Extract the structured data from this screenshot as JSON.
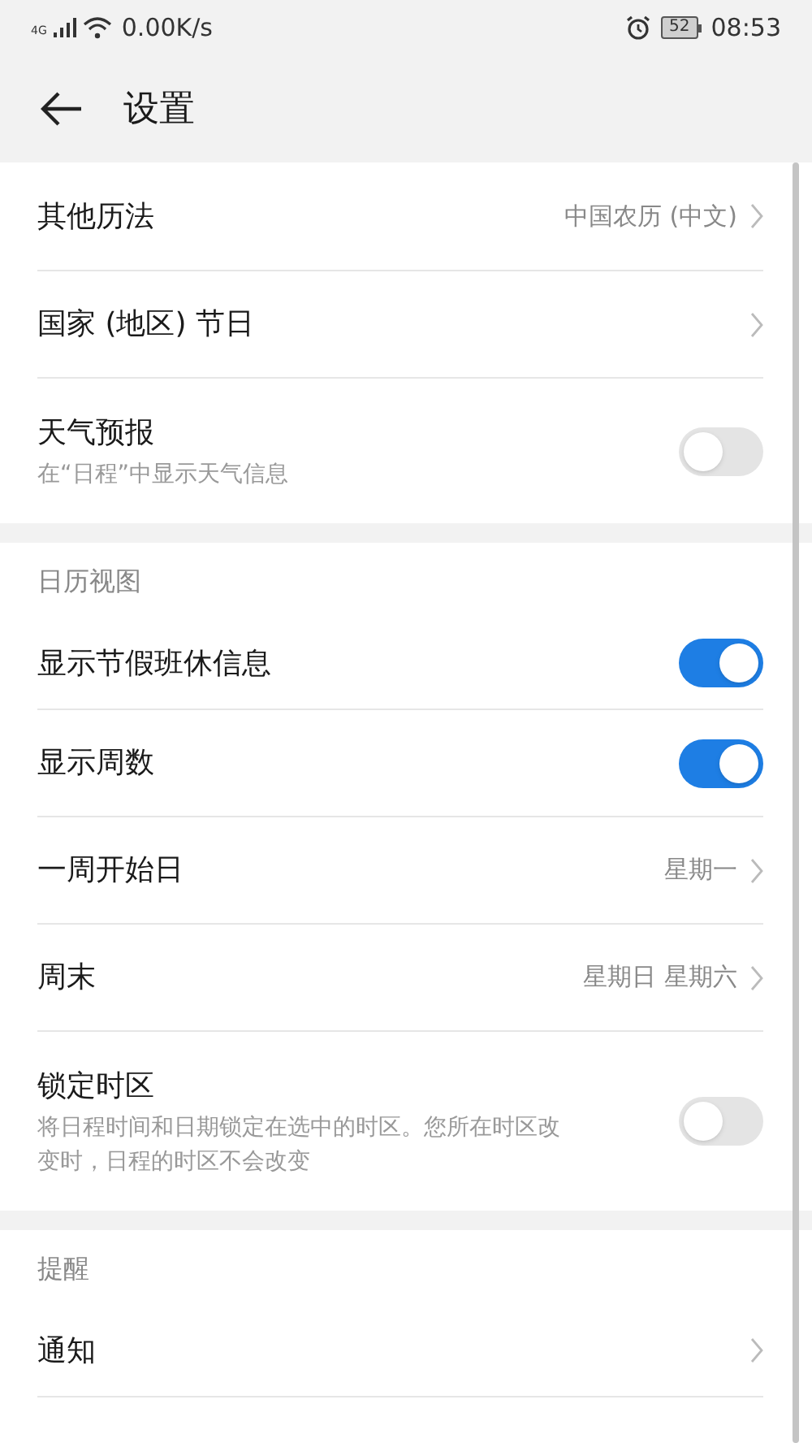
{
  "status_bar": {
    "network": "4G",
    "speed": "0.00K/s",
    "battery": "52",
    "time": "08:53"
  },
  "header": {
    "title": "设置"
  },
  "sections": [
    {
      "items": [
        {
          "kind": "nav",
          "label": "其他历法",
          "value": "中国农历 (中文)"
        },
        {
          "kind": "nav",
          "label": "国家 (地区) 节日"
        },
        {
          "kind": "toggle",
          "label": "天气预报",
          "subtitle": "在“日程”中显示天气信息",
          "on": false
        }
      ]
    },
    {
      "title": "日历视图",
      "items": [
        {
          "kind": "toggle",
          "label": "显示节假班休信息",
          "on": true
        },
        {
          "kind": "toggle",
          "label": "显示周数",
          "on": true
        },
        {
          "kind": "nav",
          "label": "一周开始日",
          "value": "星期一"
        },
        {
          "kind": "nav",
          "label": "周末",
          "value": "星期日 星期六"
        },
        {
          "kind": "toggle",
          "label": "锁定时区",
          "subtitle": "将日程时间和日期锁定在选中的时区。您所在时区改变时，日程的时区不会改变",
          "on": false
        }
      ]
    },
    {
      "title": "提醒",
      "items": [
        {
          "kind": "nav",
          "label": "通知"
        }
      ]
    }
  ]
}
